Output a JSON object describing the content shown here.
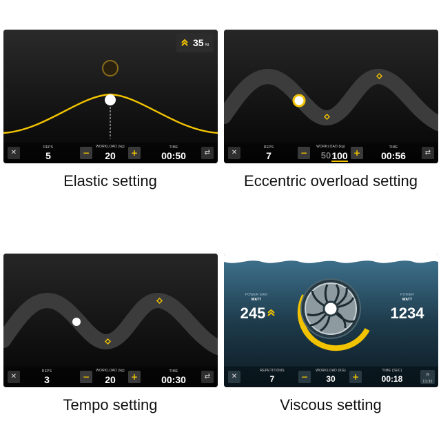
{
  "colors": {
    "accent": "#f2c300",
    "panel_bg": "#0b0b0b",
    "curve_band": "#3a3a3a",
    "water_top": "#3d6f8a",
    "water_bottom": "#0e1d26"
  },
  "icons": [
    "close-icon",
    "minus-icon",
    "plus-icon",
    "swap-icon",
    "chevrons-up-icon",
    "clock-icon"
  ],
  "panels": [
    {
      "caption": "Elastic setting",
      "badge": {
        "value": "35",
        "unit": "kg"
      },
      "reps_label": "REPS",
      "reps": "5",
      "workload_label": "WORKLOAD (kg)",
      "workload": "20",
      "time_label": "TIME",
      "time": "00:50"
    },
    {
      "caption": "Eccentric overload setting",
      "reps_label": "REPS",
      "reps": "7",
      "workload_label": "WORKLOAD (kg)",
      "workload_prev": "50",
      "workload": "100",
      "time_label": "TIME",
      "time": "00:56"
    },
    {
      "caption": "Tempo setting",
      "reps_label": "REPS",
      "reps": "3",
      "workload_label": "WORKLOAD (kg)",
      "workload": "20",
      "time_label": "TIME",
      "time": "00:30"
    },
    {
      "caption": "Viscous setting",
      "power_max_label": "POWER MAX",
      "power_max_unit": "WATT",
      "power_max": "245",
      "power_label": "POWER",
      "power_unit": "WATT",
      "power": "1234",
      "reps_label": "REPETITIONS",
      "reps": "7",
      "workload_label": "WORKLOAD (KG)",
      "workload": "30",
      "time_label": "TIME (SEC)",
      "time": "00:18",
      "clock": "11:32"
    }
  ]
}
